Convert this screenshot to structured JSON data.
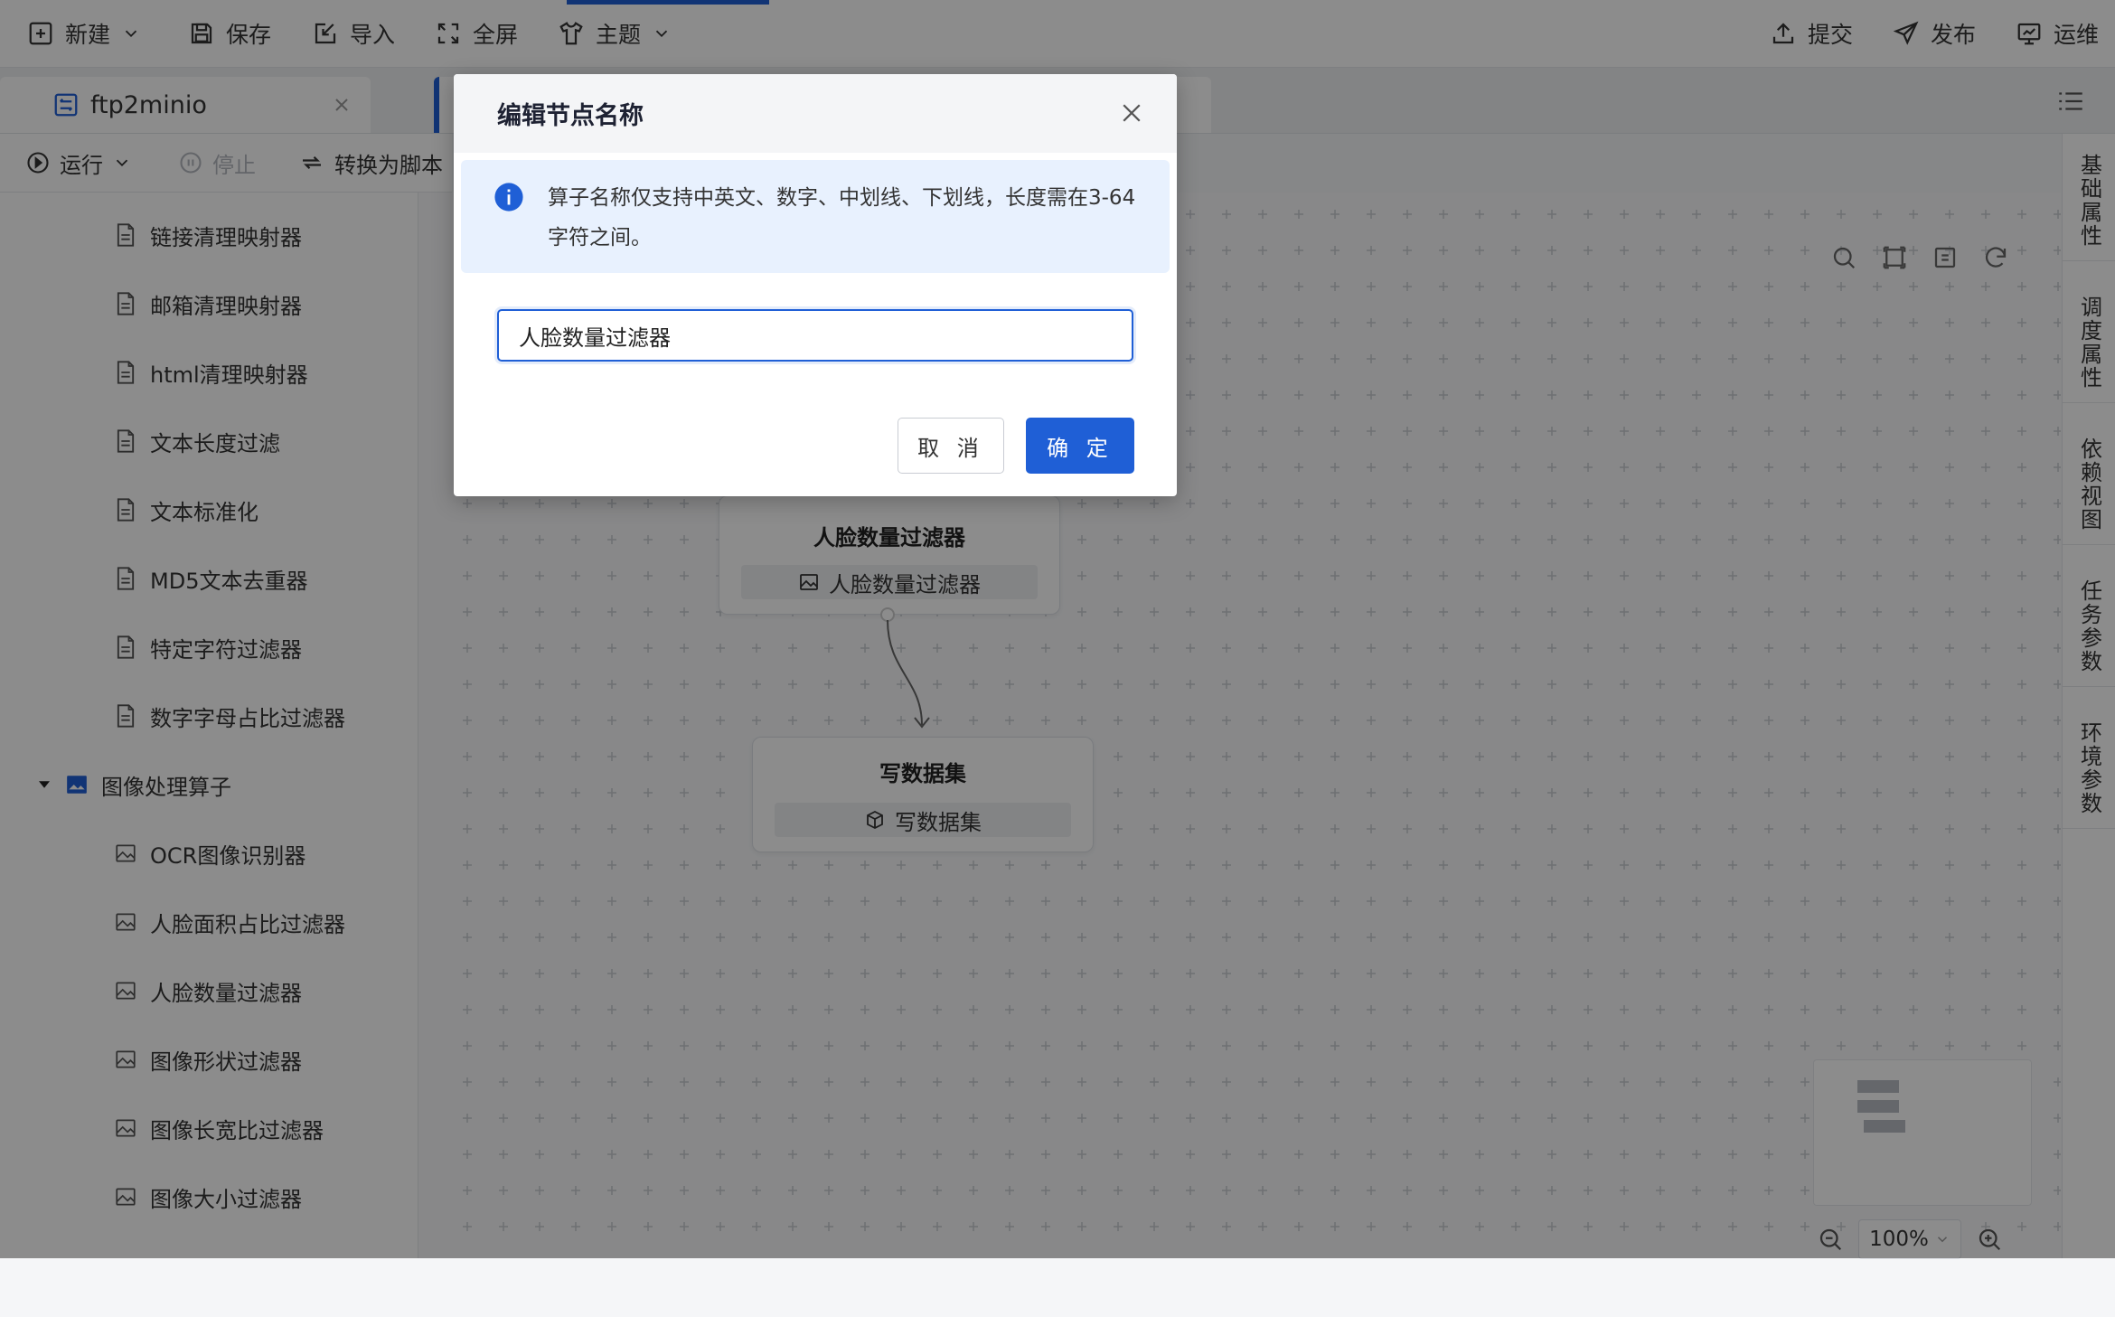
{
  "toolbar": {
    "new_label": "新建",
    "save_label": "保存",
    "import_label": "导入",
    "fullscreen_label": "全屏",
    "theme_label": "主题",
    "submit_label": "提交",
    "publish_label": "发布",
    "ops_label": "运维"
  },
  "tabs": [
    {
      "label": "ftp2minio"
    }
  ],
  "runbar": {
    "run_label": "运行",
    "stop_label": "停止",
    "convert_label": "转换为脚本"
  },
  "tree": {
    "items_top": [
      "链接清理映射器",
      "邮箱清理映射器",
      "html清理映射器",
      "文本长度过滤",
      "文本标准化",
      "MD5文本去重器",
      "特定字符过滤器",
      "数字字母占比过滤器"
    ],
    "group_label": "图像处理算子",
    "items_image": [
      "OCR图像识别器",
      "人脸面积占比过滤器",
      "人脸数量过滤器",
      "图像形状过滤器",
      "图像长宽比过滤器",
      "图像大小过滤器"
    ]
  },
  "canvas": {
    "node1": {
      "title": "人脸数量过滤器",
      "tag": "人脸数量过滤器"
    },
    "node2": {
      "title": "写数据集",
      "tag": "写数据集"
    },
    "zoom_label": "100%"
  },
  "right_tabs": [
    "基础属性",
    "调度属性",
    "依赖视图",
    "任务参数",
    "环境参数"
  ],
  "modal": {
    "title": "编辑节点名称",
    "notice": "算子名称仅支持中英文、数字、中划线、下划线，长度需在3-64字符之间。",
    "input_value": "人脸数量过滤器",
    "cancel_label": "取 消",
    "ok_label": "确 定"
  },
  "colors": {
    "primary": "#1f5fd6",
    "notice_bg": "#e8f1fe",
    "overlay": "rgba(0,0,0,0.45)"
  }
}
